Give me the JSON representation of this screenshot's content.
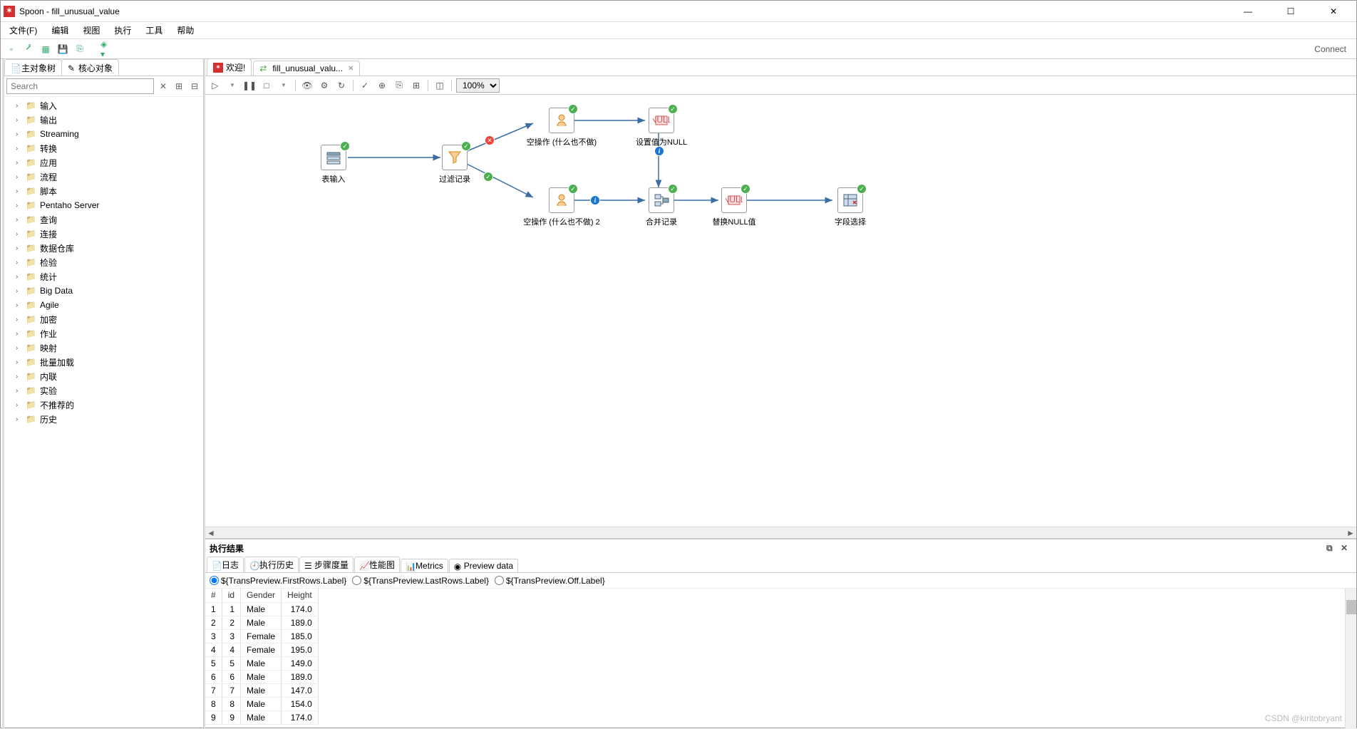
{
  "window": {
    "app": "Spoon",
    "doc": "fill_unusual_value"
  },
  "menu": [
    "文件(F)",
    "编辑",
    "视图",
    "执行",
    "工具",
    "帮助"
  ],
  "connect": "Connect",
  "sidebar": {
    "tabs": [
      "主对象树",
      "核心对象"
    ],
    "search_placeholder": "Search",
    "items": [
      "输入",
      "输出",
      "Streaming",
      "转换",
      "应用",
      "流程",
      "脚本",
      "Pentaho Server",
      "查询",
      "连接",
      "数据仓库",
      "检验",
      "统计",
      "Big Data",
      "Agile",
      "加密",
      "作业",
      "映射",
      "批量加载",
      "内联",
      "实验",
      "不推荐的",
      "历史"
    ]
  },
  "canvas_tabs": [
    {
      "label": "欢迎!",
      "icon_color": "#d32f2f"
    },
    {
      "label": "fill_unusual_valu...",
      "icon_color": "#4caf50"
    }
  ],
  "zoom": "100%",
  "nodes": {
    "table_in": {
      "label": "表输入"
    },
    "filter": {
      "label": "过滤记录"
    },
    "dummy1": {
      "label": "空操作 (什么也不做)"
    },
    "setnull": {
      "label": "设置值为NULL"
    },
    "dummy2": {
      "label": "空操作 (什么也不做) 2"
    },
    "merge": {
      "label": "合并记录"
    },
    "repnull": {
      "label": "替换NULL值"
    },
    "select": {
      "label": "字段选择"
    }
  },
  "results": {
    "title": "执行结果",
    "tabs": [
      "日志",
      "执行历史",
      "步骤度量",
      "性能图",
      "Metrics",
      "Preview data"
    ],
    "radios": [
      "${TransPreview.FirstRows.Label}",
      "${TransPreview.LastRows.Label}",
      "${TransPreview.Off.Label}"
    ],
    "columns": [
      "#",
      "id",
      "Gender",
      "Height"
    ],
    "rows": [
      [
        "1",
        "1",
        "Male",
        "174.0"
      ],
      [
        "2",
        "2",
        "Male",
        "189.0"
      ],
      [
        "3",
        "3",
        "Female",
        "185.0"
      ],
      [
        "4",
        "4",
        "Female",
        "195.0"
      ],
      [
        "5",
        "5",
        "Male",
        "149.0"
      ],
      [
        "6",
        "6",
        "Male",
        "189.0"
      ],
      [
        "7",
        "7",
        "Male",
        "147.0"
      ],
      [
        "8",
        "8",
        "Male",
        "154.0"
      ],
      [
        "9",
        "9",
        "Male",
        "174.0"
      ]
    ]
  },
  "watermark": "CSDN @kiritobryant"
}
